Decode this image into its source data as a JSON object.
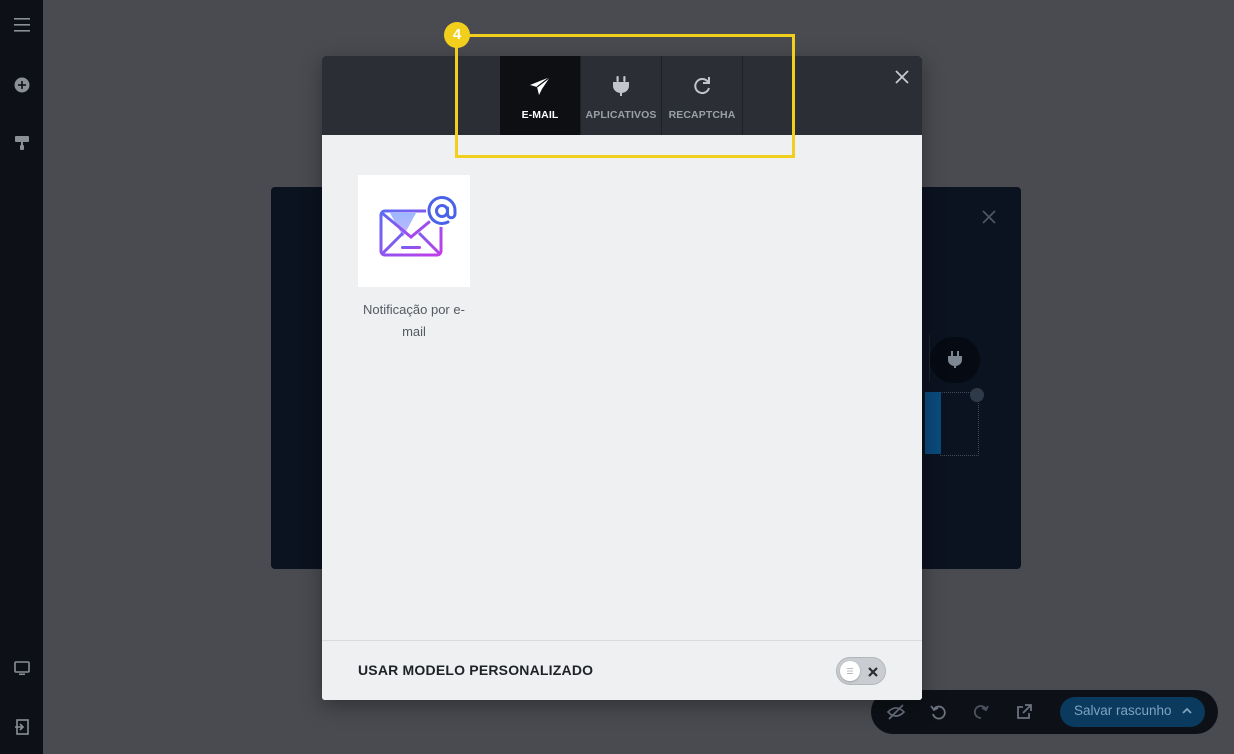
{
  "modal": {
    "tabs": [
      {
        "label": "E-MAIL",
        "icon": "paper-plane-icon",
        "active": true
      },
      {
        "label": "APLICATIVOS",
        "icon": "plug-icon",
        "active": false
      },
      {
        "label": "RECAPTCHA",
        "icon": "refresh-icon",
        "active": false
      }
    ],
    "integrations": [
      {
        "label": "Notificação por e-mail",
        "icon": "email-at-icon"
      }
    ],
    "footer": {
      "label": "USAR MODELO PERSONALIZADO",
      "toggle_on": false
    }
  },
  "annotation": {
    "step": "4",
    "color": "#f2cf1c"
  },
  "bottom_bar": {
    "save_label": "Salvar rascunho"
  },
  "colors": {
    "accent_gradient_start": "#6c63ff",
    "accent_gradient_end": "#c13ef0",
    "header_bg": "#2b2f35",
    "active_tab_bg": "#0d0f12"
  }
}
